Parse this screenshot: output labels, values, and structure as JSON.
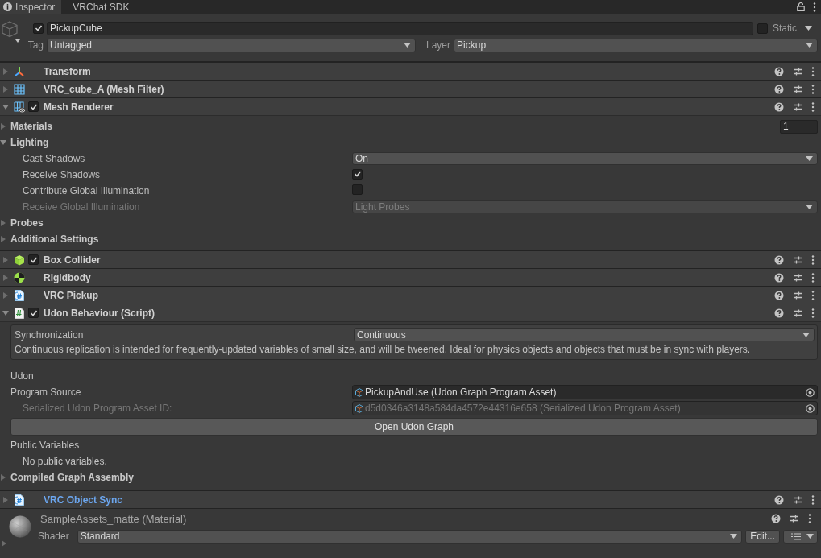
{
  "tabs": [
    {
      "label": "Inspector",
      "selected": true
    },
    {
      "label": "VRChat SDK",
      "selected": false
    }
  ],
  "object": {
    "active": true,
    "name": "PickupCube",
    "static": false,
    "static_label": "Static",
    "tag_label": "Tag",
    "tag": "Untagged",
    "layer_label": "Layer",
    "layer": "Pickup"
  },
  "components": [
    {
      "kind": "transform",
      "name": "Transform",
      "expanded": false
    },
    {
      "kind": "mesh-filter",
      "name": "VRC_cube_A (Mesh Filter)",
      "expanded": false
    },
    {
      "kind": "mesh-renderer",
      "name": "Mesh Renderer",
      "expanded": true,
      "enabled": true,
      "properties": [
        {
          "kind": "foldout",
          "label": "Materials",
          "expanded": false,
          "value": "1"
        },
        {
          "kind": "foldout",
          "label": "Lighting",
          "expanded": true,
          "children": [
            {
              "kind": "dropdown",
              "label": "Cast Shadows",
              "value": "On",
              "disabled": false
            },
            {
              "kind": "checkbox",
              "label": "Receive Shadows",
              "checked": true,
              "disabled": false
            },
            {
              "kind": "checkbox",
              "label": "Contribute Global Illumination",
              "checked": false,
              "disabled": false
            },
            {
              "kind": "dropdown",
              "label": "Receive Global Illumination",
              "value": "Light Probes",
              "disabled": true
            }
          ]
        },
        {
          "kind": "foldout",
          "label": "Probes",
          "expanded": false
        },
        {
          "kind": "foldout",
          "label": "Additional Settings",
          "expanded": false
        }
      ]
    },
    {
      "kind": "box-collider",
      "name": "Box Collider",
      "expanded": false,
      "enabled": true
    },
    {
      "kind": "rigidbody",
      "name": "Rigidbody",
      "expanded": false
    },
    {
      "kind": "script",
      "name": "VRC Pickup",
      "expanded": false
    },
    {
      "kind": "udon",
      "name": "Udon Behaviour (Script)",
      "expanded": true,
      "enabled": true,
      "properties": [
        {
          "kind": "sync-box",
          "label": "Synchronization",
          "value": "Continuous",
          "description": "Continuous replication is intended for frequently-updated variables of small size, and will be tweened. Ideal for physics objects and objects that must be in sync with players."
        },
        {
          "kind": "heading",
          "label": "Udon"
        },
        {
          "kind": "object-field",
          "label": "Program Source",
          "value": "PickupAndUse (Udon Graph Program Asset)",
          "disabled": false
        },
        {
          "kind": "object-field",
          "label": "Serialized Udon Program Asset ID:",
          "value": "d5d0346a3148a584da4572e44316e658 (Serialized Udon Program Asset)",
          "disabled": true
        },
        {
          "kind": "button",
          "label": "Open Udon Graph"
        },
        {
          "kind": "heading",
          "label": "Public Variables"
        },
        {
          "kind": "note",
          "text": "No public variables."
        },
        {
          "kind": "foldout",
          "label": "Compiled Graph Assembly",
          "expanded": false
        }
      ]
    },
    {
      "kind": "script",
      "name": "VRC Object Sync",
      "expanded": false,
      "overridden": true
    }
  ],
  "material": {
    "name": "SampleAssets_matte (Material)",
    "expanded": false,
    "shader_label": "Shader",
    "shader": "Standard",
    "edit_label": "Edit..."
  }
}
